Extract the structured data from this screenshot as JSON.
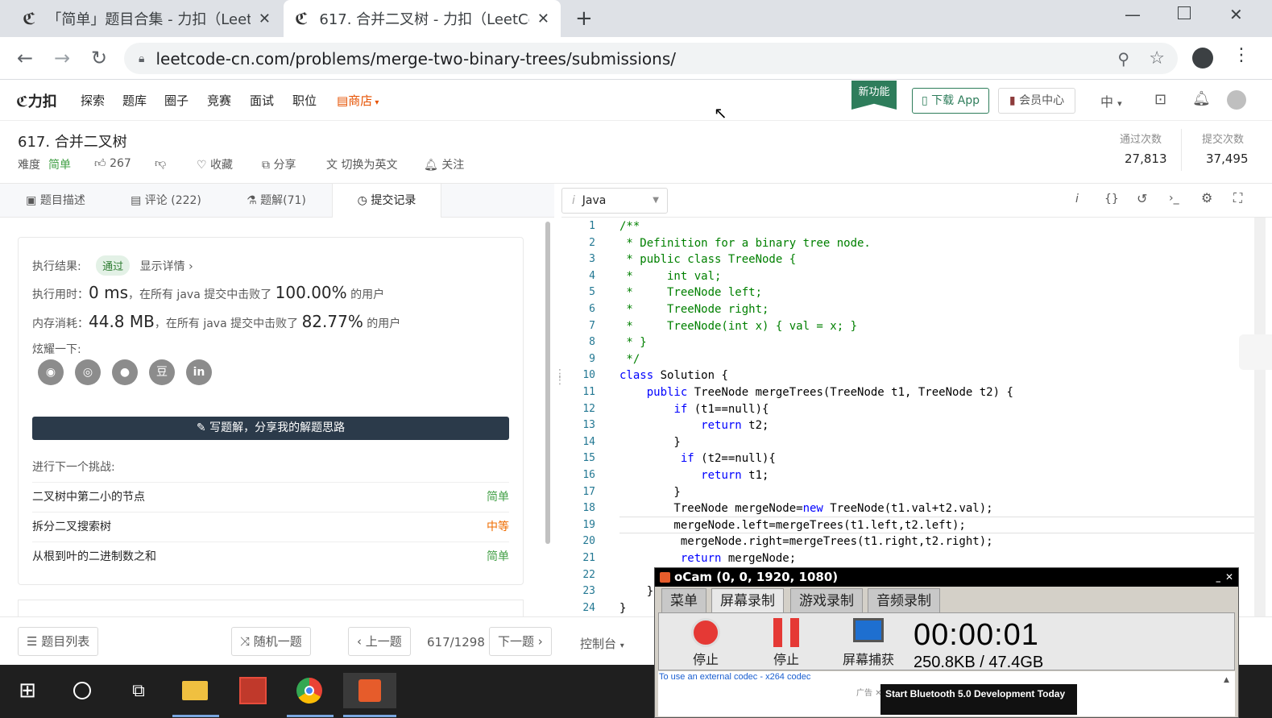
{
  "browser": {
    "tabs": [
      {
        "title": "「简单」题目合集 - 力扣（LeetC",
        "active": false
      },
      {
        "title": "617. 合并二叉树 - 力扣（LeetCo",
        "active": true
      }
    ],
    "url": "leetcode-cn.com/problems/merge-two-binary-trees/submissions/"
  },
  "nav": {
    "logo": "力扣",
    "links": [
      "探索",
      "题库",
      "圈子",
      "竞赛",
      "面试",
      "职位"
    ],
    "store": "商店",
    "new_feature": "新功能",
    "download_app": "下载 App",
    "vip": "会员中心",
    "lang": "中"
  },
  "problem": {
    "title": "617. 合并二叉树",
    "difficulty_label": "难度",
    "difficulty": "简单",
    "likes": "267",
    "favorite": "收藏",
    "share": "分享",
    "switch_lang": "切换为英文",
    "follow": "关注",
    "accepted_label": "通过次数",
    "accepted": "27,813",
    "submissions_label": "提交次数",
    "submissions": "37,495"
  },
  "left_tabs": [
    "题目描述",
    "评论 (222)",
    "题解(71)",
    "提交记录"
  ],
  "result": {
    "exec_label": "执行结果:",
    "status": "通过",
    "details": "显示详情 ›",
    "time_label": "执行用时：",
    "time_value": "0 ms",
    "time_mid": "，在所有 java 提交中击败了",
    "time_pct": "100.00%",
    "time_end": "的用户",
    "mem_label": "内存消耗：",
    "mem_value": "44.8 MB",
    "mem_mid": "，在所有 java 提交中击败了",
    "mem_pct": "82.77%",
    "mem_end": "的用户",
    "share_label": "炫耀一下:",
    "share_icons": [
      "wechat-icon",
      "weibo-icon",
      "qq-icon",
      "douban-icon",
      "linkedin-icon"
    ],
    "linkedin_text": "in",
    "douban_text": "豆",
    "write_solution": "写题解，分享我的解题思路",
    "next_label": "进行下一个挑战:",
    "next": [
      {
        "name": "二叉树中第二小的节点",
        "level": "简单",
        "color": "#43a047"
      },
      {
        "name": "拆分二叉搜索树",
        "level": "中等",
        "color": "#ef6c00"
      },
      {
        "name": "从根到叶的二进制数之和",
        "level": "简单",
        "color": "#43a047"
      }
    ]
  },
  "editor": {
    "language": "Java",
    "lines": [
      {
        "n": "1",
        "t": "/**",
        "c": "cm"
      },
      {
        "n": "2",
        "t": " * Definition for a binary tree node.",
        "c": "cm"
      },
      {
        "n": "3",
        "t": " * public class TreeNode {",
        "c": "cm"
      },
      {
        "n": "4",
        "t": " *     int val;",
        "c": "cm"
      },
      {
        "n": "5",
        "t": " *     TreeNode left;",
        "c": "cm"
      },
      {
        "n": "6",
        "t": " *     TreeNode right;",
        "c": "cm"
      },
      {
        "n": "7",
        "t": " *     TreeNode(int x) { val = x; }",
        "c": "cm"
      },
      {
        "n": "8",
        "t": " * }",
        "c": "cm"
      },
      {
        "n": "9",
        "t": " */",
        "c": "cm"
      },
      {
        "n": "10",
        "t": "class Solution {",
        "c": ""
      },
      {
        "n": "11",
        "t": "    public TreeNode mergeTrees(TreeNode t1, TreeNode t2) {",
        "c": ""
      },
      {
        "n": "12",
        "t": "        if (t1==null){",
        "c": ""
      },
      {
        "n": "13",
        "t": "            return t2;",
        "c": ""
      },
      {
        "n": "14",
        "t": "        }",
        "c": ""
      },
      {
        "n": "15",
        "t": "         if (t2==null){",
        "c": ""
      },
      {
        "n": "16",
        "t": "            return t1;",
        "c": ""
      },
      {
        "n": "17",
        "t": "        }",
        "c": ""
      },
      {
        "n": "18",
        "t": "        TreeNode mergeNode=new TreeNode(t1.val+t2.val);",
        "c": ""
      },
      {
        "n": "19",
        "t": "        mergeNode.left=mergeTrees(t1.left,t2.left);",
        "c": ""
      },
      {
        "n": "20",
        "t": "         mergeNode.right=mergeTrees(t1.right,t2.right);",
        "c": ""
      },
      {
        "n": "21",
        "t": "         return mergeNode;",
        "c": ""
      },
      {
        "n": "22",
        "t": "",
        "c": ""
      },
      {
        "n": "23",
        "t": "    }",
        "c": ""
      },
      {
        "n": "24",
        "t": "}",
        "c": ""
      }
    ]
  },
  "bottom": {
    "problem_list": "题目列表",
    "random": "随机一题",
    "prev": "上一题",
    "page": "617/1298",
    "next": "下一题",
    "console": "控制台"
  },
  "ocam": {
    "title": "oCam (0, 0, 1920, 1080)",
    "tabs": [
      "菜单",
      "屏幕录制",
      "游戏录制",
      "音频录制"
    ],
    "stop1": "停止",
    "stop2": "停止",
    "capture": "屏幕捕获",
    "timer": "00:00:01",
    "size": "250.8KB / 47.4GB",
    "codec_note": "To use an external codec - x264 codec",
    "ad_label": "广告",
    "ad_text": "Start Bluetooth 5.0 Development Today"
  }
}
